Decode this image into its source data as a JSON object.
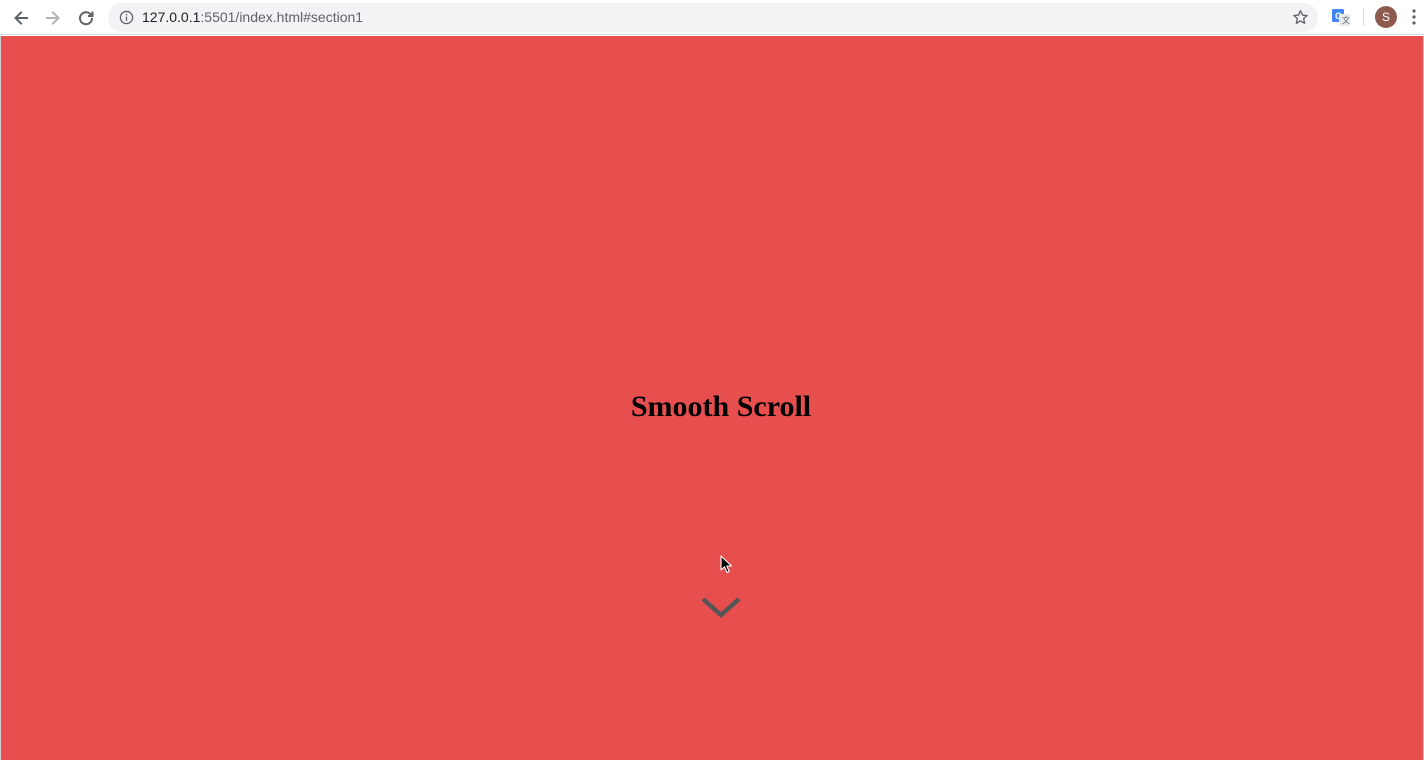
{
  "browser": {
    "url_host": "127.0.0.1",
    "url_rest": ":5501/index.html#section1",
    "profile_initial": "S",
    "icons": {
      "back": "arrow-left-icon",
      "forward": "arrow-right-icon",
      "reload": "reload-icon",
      "info": "info-icon",
      "bookmark": "star-icon",
      "extension": "translate-icon",
      "menu": "kebab-menu-icon"
    }
  },
  "page": {
    "heading": "Smooth Scroll",
    "background_color": "#e74e4e",
    "scroll_icon": "chevron-down-icon",
    "scroll_icon_color": "#555555"
  }
}
